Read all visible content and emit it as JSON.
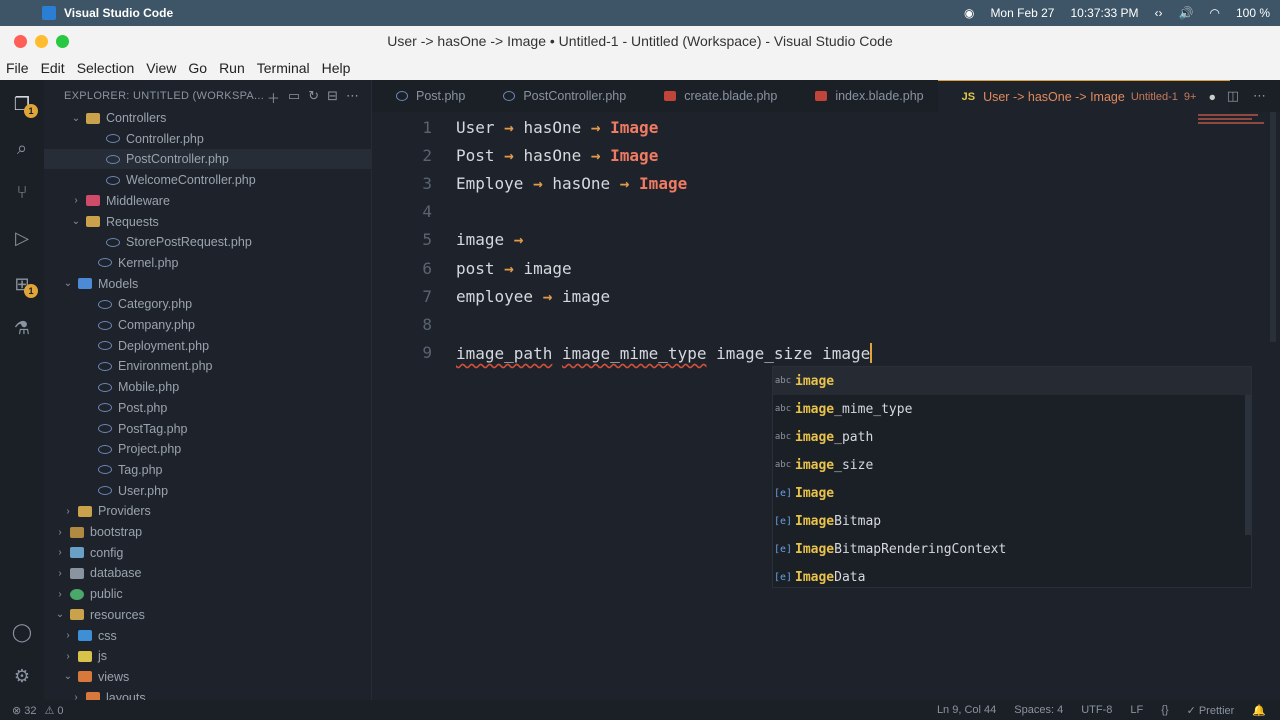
{
  "macbar": {
    "app_name": "Visual Studio Code",
    "date": "Mon Feb 27",
    "time": "10:37:33 PM",
    "battery": "100 %"
  },
  "window": {
    "title": "User -> hasOne -> Image • Untitled-1 - Untitled (Workspace) - Visual Studio Code"
  },
  "menu": [
    "File",
    "Edit",
    "Selection",
    "View",
    "Go",
    "Run",
    "Terminal",
    "Help"
  ],
  "activity": {
    "explorer_badge": "1",
    "extensions_badge": "1"
  },
  "explorer": {
    "header": "EXPLORER: UNTITLED (WORKSPA...",
    "tree": [
      {
        "label": "Controllers",
        "indent": 84,
        "chev": "⌄",
        "icon": "folder"
      },
      {
        "label": "Controller.php",
        "indent": 104,
        "chev": "",
        "icon": "php"
      },
      {
        "label": "PostController.php",
        "indent": 104,
        "chev": "",
        "icon": "php",
        "selected": true
      },
      {
        "label": "WelcomeController.php",
        "indent": 104,
        "chev": "",
        "icon": "php"
      },
      {
        "label": "Middleware",
        "indent": 84,
        "chev": "›",
        "icon": "mid"
      },
      {
        "label": "Requests",
        "indent": 84,
        "chev": "⌄",
        "icon": "folder"
      },
      {
        "label": "StorePostRequest.php",
        "indent": 104,
        "chev": "",
        "icon": "php"
      },
      {
        "label": "Kernel.php",
        "indent": 96,
        "chev": "",
        "icon": "php"
      },
      {
        "label": "Models",
        "indent": 76,
        "chev": "⌄",
        "icon": "models"
      },
      {
        "label": "Category.php",
        "indent": 96,
        "chev": "",
        "icon": "php"
      },
      {
        "label": "Company.php",
        "indent": 96,
        "chev": "",
        "icon": "php"
      },
      {
        "label": "Deployment.php",
        "indent": 96,
        "chev": "",
        "icon": "php"
      },
      {
        "label": "Environment.php",
        "indent": 96,
        "chev": "",
        "icon": "php"
      },
      {
        "label": "Mobile.php",
        "indent": 96,
        "chev": "",
        "icon": "php"
      },
      {
        "label": "Post.php",
        "indent": 96,
        "chev": "",
        "icon": "php"
      },
      {
        "label": "PostTag.php",
        "indent": 96,
        "chev": "",
        "icon": "php"
      },
      {
        "label": "Project.php",
        "indent": 96,
        "chev": "",
        "icon": "php"
      },
      {
        "label": "Tag.php",
        "indent": 96,
        "chev": "",
        "icon": "php"
      },
      {
        "label": "User.php",
        "indent": 96,
        "chev": "",
        "icon": "php"
      },
      {
        "label": "Providers",
        "indent": 76,
        "chev": "›",
        "icon": "folder"
      },
      {
        "label": "bootstrap",
        "indent": 68,
        "chev": "›",
        "icon": "bootstrap"
      },
      {
        "label": "config",
        "indent": 68,
        "chev": "›",
        "icon": "config"
      },
      {
        "label": "database",
        "indent": 68,
        "chev": "›",
        "icon": "db"
      },
      {
        "label": "public",
        "indent": 68,
        "chev": "›",
        "icon": "public"
      },
      {
        "label": "resources",
        "indent": 68,
        "chev": "⌄",
        "icon": "folder"
      },
      {
        "label": "css",
        "indent": 76,
        "chev": "›",
        "icon": "css"
      },
      {
        "label": "js",
        "indent": 76,
        "chev": "›",
        "icon": "js"
      },
      {
        "label": "views",
        "indent": 76,
        "chev": "⌄",
        "icon": "views"
      },
      {
        "label": "layouts",
        "indent": 84,
        "chev": "›",
        "icon": "views"
      }
    ]
  },
  "tabs": [
    {
      "label": "Post.php",
      "icon": "php"
    },
    {
      "label": "PostController.php",
      "icon": "php"
    },
    {
      "label": "create.blade.php",
      "icon": "blade"
    },
    {
      "label": "index.blade.php",
      "icon": "blade"
    }
  ],
  "active_tab": {
    "lang": "JS",
    "label": "User -> hasOne -> Image",
    "file": "Untitled-1",
    "problems": "9+",
    "dirty": "●"
  },
  "editor": {
    "lines": [
      {
        "n": "1",
        "parts": [
          [
            "User ",
            ""
          ],
          [
            "→",
            "arr"
          ],
          [
            " hasOne ",
            ""
          ],
          [
            "→",
            "arr"
          ],
          [
            " ",
            ""
          ],
          [
            "Image",
            "kw"
          ]
        ]
      },
      {
        "n": "2",
        "parts": [
          [
            "Post ",
            ""
          ],
          [
            "→",
            "arr"
          ],
          [
            " hasOne ",
            ""
          ],
          [
            "→",
            "arr"
          ],
          [
            " ",
            ""
          ],
          [
            "Image",
            "kw"
          ]
        ]
      },
      {
        "n": "3",
        "parts": [
          [
            "Employe ",
            ""
          ],
          [
            "→",
            "arr"
          ],
          [
            " hasOne ",
            ""
          ],
          [
            "→",
            "arr"
          ],
          [
            " ",
            ""
          ],
          [
            "Image",
            "kw"
          ]
        ]
      },
      {
        "n": "4",
        "parts": []
      },
      {
        "n": "5",
        "parts": [
          [
            "image ",
            ""
          ],
          [
            "→",
            "arr"
          ]
        ]
      },
      {
        "n": "6",
        "parts": [
          [
            "post ",
            ""
          ],
          [
            "→",
            "arr"
          ],
          [
            " image",
            ""
          ]
        ]
      },
      {
        "n": "7",
        "parts": [
          [
            "employee ",
            ""
          ],
          [
            "→",
            "arr"
          ],
          [
            " image",
            ""
          ]
        ]
      },
      {
        "n": "8",
        "parts": []
      },
      {
        "n": "9",
        "parts": [
          [
            "image_path",
            "sq"
          ],
          [
            " ",
            ""
          ],
          [
            "image_mime_type",
            "sq"
          ],
          [
            " image_size image",
            ""
          ]
        ],
        "cursor": true
      }
    ]
  },
  "suggestions": [
    {
      "kind": "abc",
      "hl": "image",
      "rest": "",
      "selected": true
    },
    {
      "kind": "abc",
      "hl": "image",
      "rest": "_mime_type"
    },
    {
      "kind": "abc",
      "hl": "image",
      "rest": "_path"
    },
    {
      "kind": "abc",
      "hl": "image",
      "rest": "_size"
    },
    {
      "kind": "[e]",
      "hl": "Image",
      "rest": ""
    },
    {
      "kind": "[e]",
      "hl": "Image",
      "rest": "Bitmap"
    },
    {
      "kind": "[e]",
      "hl": "Image",
      "rest": "BitmapRenderingContext"
    },
    {
      "kind": "[e]",
      "hl": "Image",
      "rest": "Data"
    }
  ],
  "status": {
    "errors": "⊗ 32",
    "warnings": "⚠ 0",
    "position": "Ln 9, Col 44",
    "spaces": "Spaces: 4",
    "encoding": "UTF-8",
    "eol": "LF",
    "lang": "{}",
    "prettier": "✓ Prettier",
    "bell": "🔔"
  }
}
